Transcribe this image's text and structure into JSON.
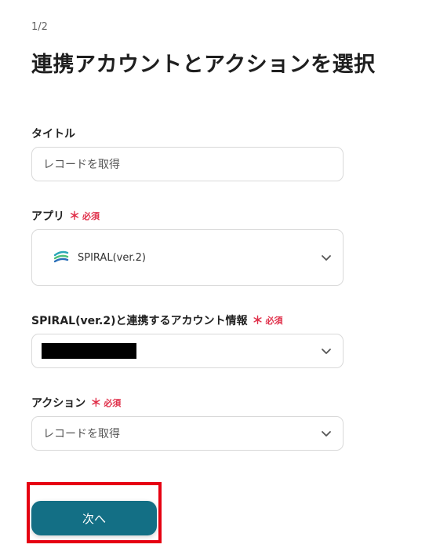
{
  "header": {
    "step": "1/2",
    "title": "連携アカウントとアクションを選択"
  },
  "fields": {
    "title": {
      "label": "タイトル",
      "value": "レコードを取得"
    },
    "app": {
      "label": "アプリ",
      "required": "必須",
      "value": "SPIRAL(ver.2)"
    },
    "account": {
      "label": "SPIRAL(ver.2)と連携するアカウント情報",
      "required": "必須"
    },
    "action": {
      "label": "アクション",
      "required": "必須",
      "value": "レコードを取得"
    }
  },
  "footer": {
    "next_label": "次へ"
  },
  "colors": {
    "primary": "#136f85",
    "required": "#e0304a",
    "highlight": "#e60012"
  },
  "icons": {
    "chevron": "chevron-down-icon",
    "app_logo": "spiral-logo-icon"
  }
}
